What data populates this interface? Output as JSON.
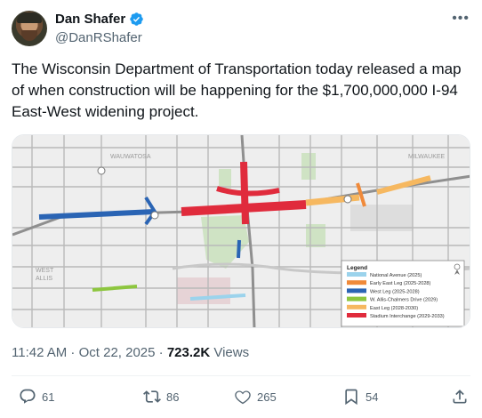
{
  "author": {
    "name": "Dan Shafer",
    "handle": "@DanRShafer"
  },
  "more_icon": "more-icon",
  "tweet_text": "The Wisconsin Department of Transportation today released a map of when construction will be happening for the $1,700,000,000 I-94 East-West widening project.",
  "map": {
    "places": {
      "wauwatosa": "WAUWATOSA",
      "milwaukee": "MILWAUKEE",
      "west_allis_1": "WEST",
      "west_allis_2": "ALLIS"
    },
    "legend": {
      "title": "Legend",
      "items": [
        {
          "label": "National Avenue (2025)",
          "color": "#9bd3ec"
        },
        {
          "label": "Early East Leg (2025-2028)",
          "color": "#f08a3a"
        },
        {
          "label": "West Leg (2025-2028)",
          "color": "#2a64b4"
        },
        {
          "label": "W. Allis-Chalmers Drive (2029)",
          "color": "#8dc63f"
        },
        {
          "label": "East Leg (2028-2030)",
          "color": "#f6b860"
        },
        {
          "label": "Stadium Interchange (2029-2033)",
          "color": "#e02b3c"
        }
      ]
    }
  },
  "meta": {
    "time": "11:42 AM · Oct 22, 2025 · ",
    "views_count": "723.2K",
    "views_label": " Views"
  },
  "actions": {
    "replies": "61",
    "reposts": "86",
    "likes": "265",
    "bookmarks": "54"
  },
  "colors": {
    "text": "#0f1419",
    "secondary": "#536471",
    "verified": "#1d9bf0"
  }
}
